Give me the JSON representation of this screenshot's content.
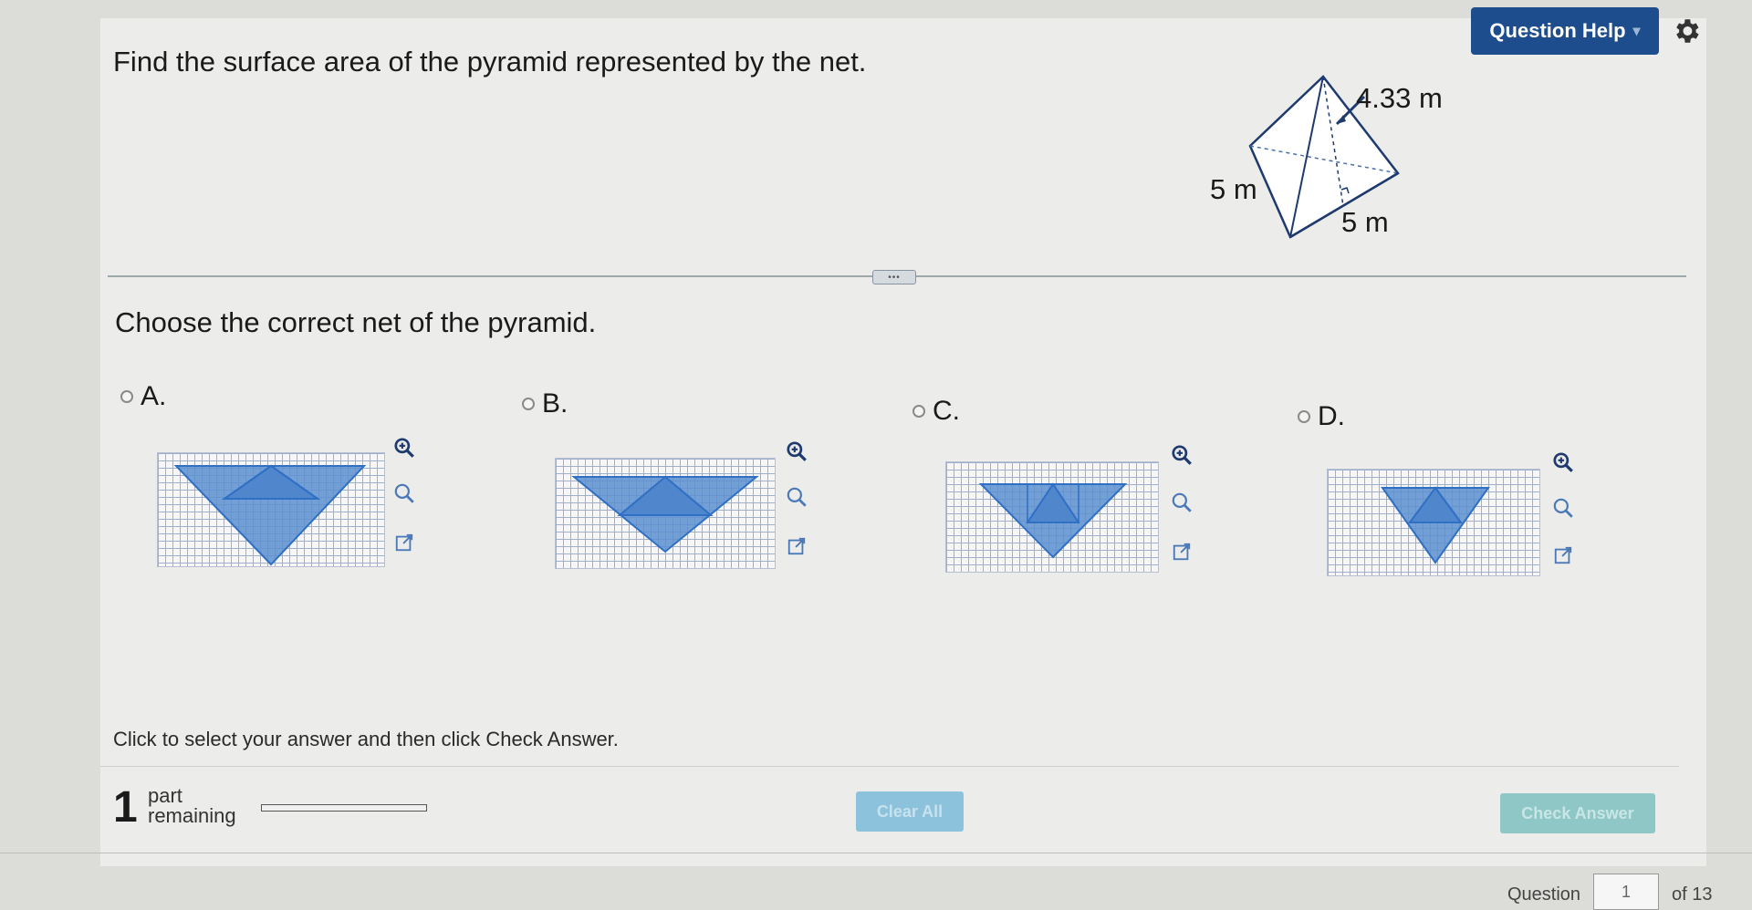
{
  "header": {
    "help_label": "Question Help",
    "help_caret": "▾",
    "settings_icon": "gear-icon"
  },
  "question": {
    "text": "Find the surface area of the pyramid represented by the net.",
    "figure": {
      "slant_label": "4.33 m",
      "side_label_left": "5 m",
      "side_label_bottom": "5 m"
    }
  },
  "divider_handle": "•••",
  "prompt": "Choose the correct net of the pyramid.",
  "options": [
    {
      "letter": "A."
    },
    {
      "letter": "B."
    },
    {
      "letter": "C."
    },
    {
      "letter": "D."
    }
  ],
  "option_icons": [
    "zoom-in-icon",
    "zoom-out-icon",
    "popout-icon"
  ],
  "instruction": "Click to select your answer and then click Check Answer.",
  "parts": {
    "count": "1",
    "line1": "part",
    "line2": "remaining",
    "progress": 0
  },
  "buttons": {
    "clear_all": "Clear All",
    "check_answer": "Check Answer"
  },
  "footer": {
    "question_label": "Question",
    "question_number": "1",
    "of_total": "of 13"
  },
  "colors": {
    "help_button": "#1d4d8c",
    "net_fill": "#5b8fd0",
    "net_stroke": "#2f6fc4"
  }
}
